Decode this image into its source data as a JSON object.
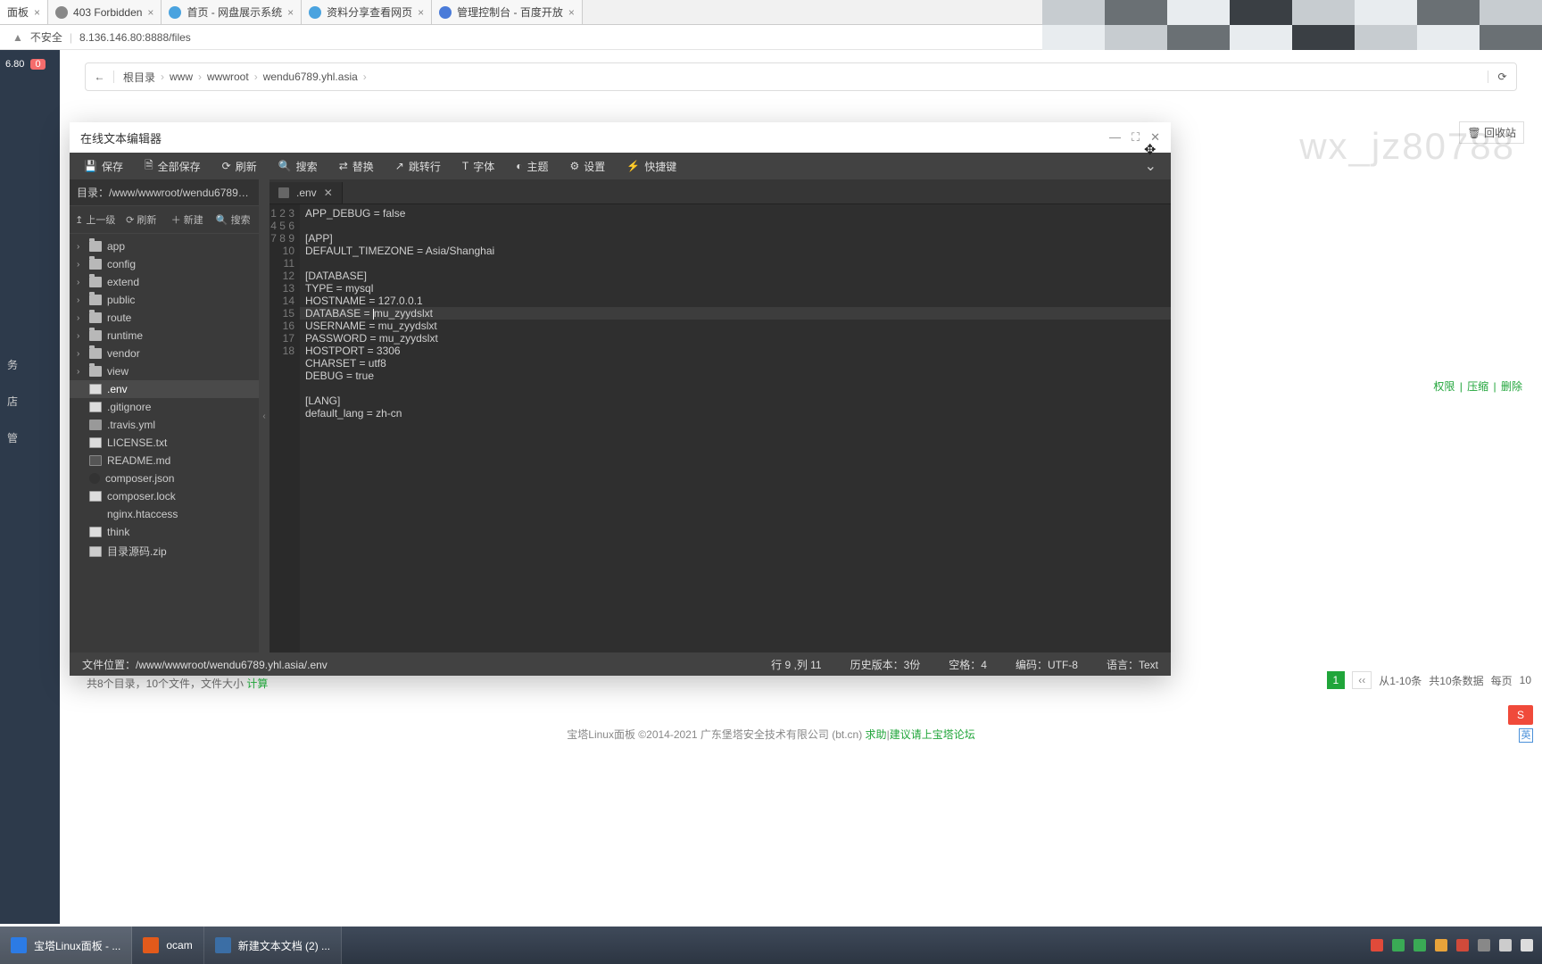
{
  "browser": {
    "tabs": [
      {
        "label": "面板",
        "active": true
      },
      {
        "label": "403 Forbidden",
        "active": false
      },
      {
        "label": "首页 - 网盘展示系统",
        "active": false
      },
      {
        "label": "资料分享查看网页",
        "active": false
      },
      {
        "label": "管理控制台 - 百度开放",
        "active": false
      }
    ],
    "url_prefix": "不安全",
    "url": "8.136.146.80:8888/files"
  },
  "left_nav": {
    "ip": "6.80",
    "badge": "0",
    "items": [
      "务",
      "店",
      "管"
    ]
  },
  "breadcrumb": {
    "root": "根目录",
    "parts": [
      "www",
      "wwwroot",
      "wendu6789.yhl.asia"
    ]
  },
  "recycle": "回收站",
  "actions_right": [
    "权限",
    "压缩",
    "删除"
  ],
  "watermark": "wx_jz80788",
  "editor": {
    "title": "在线文本编辑器",
    "dir_label": "目录：",
    "dir_path": "/www/wwwroot/wendu6789.yhl....",
    "dir_actions": {
      "up": "上一级",
      "refresh": "刷新",
      "new": "新建",
      "search": "搜索"
    },
    "toolbar": {
      "save": "保存",
      "save_all": "全部保存",
      "refresh": "刷新",
      "search": "搜索",
      "replace": "替换",
      "goto": "跳转行",
      "font": "字体",
      "theme": "主题",
      "settings": "设置",
      "shortcut": "快捷键"
    },
    "tree": {
      "folders": [
        "app",
        "config",
        "extend",
        "public",
        "route",
        "runtime",
        "vendor",
        "view"
      ],
      "files": [
        {
          "name": ".env",
          "icon": "file-generic",
          "selected": true
        },
        {
          "name": ".gitignore",
          "icon": "file-generic"
        },
        {
          "name": ".travis.yml",
          "icon": "file-y"
        },
        {
          "name": "LICENSE.txt",
          "icon": "file-generic"
        },
        {
          "name": "README.md",
          "icon": "file-md"
        },
        {
          "name": "composer.json",
          "icon": "file-json"
        },
        {
          "name": "composer.lock",
          "icon": "file-generic"
        },
        {
          "name": "nginx.htaccess",
          "icon": ""
        },
        {
          "name": "think",
          "icon": "file-generic"
        },
        {
          "name": "目录源码.zip",
          "icon": "file-zip"
        }
      ]
    },
    "open_tab": ".env",
    "code_lines": [
      "APP_DEBUG = false",
      "",
      "[APP]",
      "DEFAULT_TIMEZONE = Asia/Shanghai",
      "",
      "[DATABASE]",
      "TYPE = mysql",
      "HOSTNAME = 127.0.0.1",
      "DATABASE = mu_zyydslxt",
      "USERNAME = mu_zyydslxt",
      "PASSWORD = mu_zyydslxt",
      "HOSTPORT = 3306",
      "CHARSET = utf8",
      "DEBUG = true",
      "",
      "[LANG]",
      "default_lang = zh-cn",
      ""
    ],
    "current_line_index": 8,
    "status": {
      "path_label": "文件位置：",
      "path": "/www/wwwroot/wendu6789.yhl.asia/.env",
      "cursor": "行 9 ,列 11",
      "history": "历史版本：3份",
      "indent": "空格：4",
      "encoding": "编码：UTF-8",
      "lang": "语言：Text"
    }
  },
  "page_footer": {
    "stats_prefix": "共8个目录，10个文件，文件大小 ",
    "stats_link": "计算",
    "pager": {
      "page": "1",
      "prev": "‹‹",
      "info": "从1-10条",
      "total": "共10条数据",
      "per": "每页",
      "size": "10"
    }
  },
  "copyright": {
    "text": "宝塔Linux面板 ©2014-2021 广东堡塔安全技术有限公司 (bt.cn)   ",
    "links": [
      "求助",
      "建议请上宝塔论坛"
    ]
  },
  "taskbar": {
    "items": [
      {
        "label": "宝塔Linux面板 - ...",
        "color": "#2c7be5"
      },
      {
        "label": "ocam",
        "color": "#e25a1b"
      },
      {
        "label": "新建文本文档 (2) ...",
        "color": "#3b6ea5"
      }
    ]
  },
  "ime": {
    "badge": "S",
    "lang": "英"
  }
}
